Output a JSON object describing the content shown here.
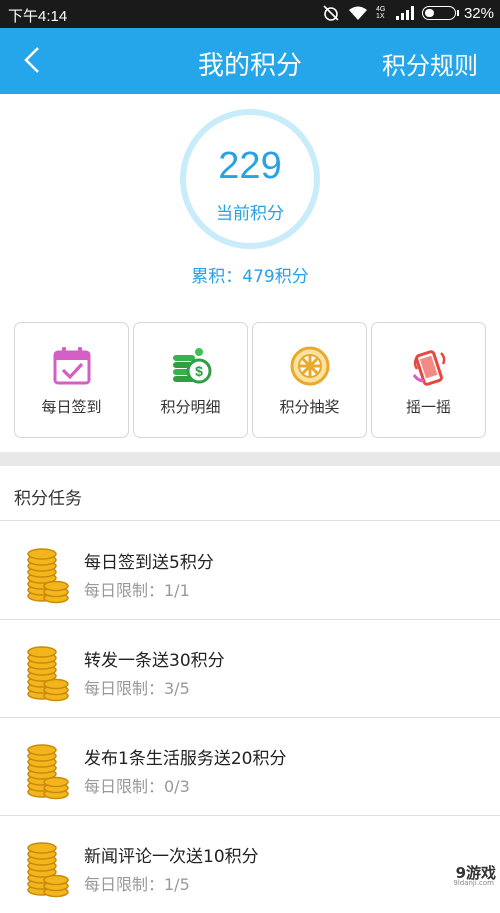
{
  "status_bar": {
    "time": "下午4:14",
    "network": "4G 1X",
    "battery": "32%"
  },
  "header": {
    "title": "我的积分",
    "rules_link": "积分规则"
  },
  "points": {
    "current": "229",
    "current_label": "当前积分",
    "total": "累积：479积分"
  },
  "actions": [
    {
      "label": "每日签到",
      "icon": "calendar-check-icon"
    },
    {
      "label": "积分明细",
      "icon": "coin-stack-dollar-icon"
    },
    {
      "label": "积分抽奖",
      "icon": "lottery-wheel-icon"
    },
    {
      "label": "摇一摇",
      "icon": "shake-phone-icon"
    }
  ],
  "tasks": {
    "section_title": "积分任务",
    "items": [
      {
        "name": "每日签到送5积分",
        "limit": "每日限制：1/1"
      },
      {
        "name": "转发一条送30积分",
        "limit": "每日限制：3/5"
      },
      {
        "name": "发布1条生活服务送20积分",
        "limit": "每日限制：0/3"
      },
      {
        "name": "新闻评论一次送10积分",
        "limit": "每日限制：1/5"
      }
    ]
  },
  "watermark": {
    "logo": "9游戏",
    "url": "9ldanji.com"
  },
  "colors": {
    "primary": "#25a6ea",
    "ring": "#c8ecfa",
    "coin": "#f3b51c"
  }
}
